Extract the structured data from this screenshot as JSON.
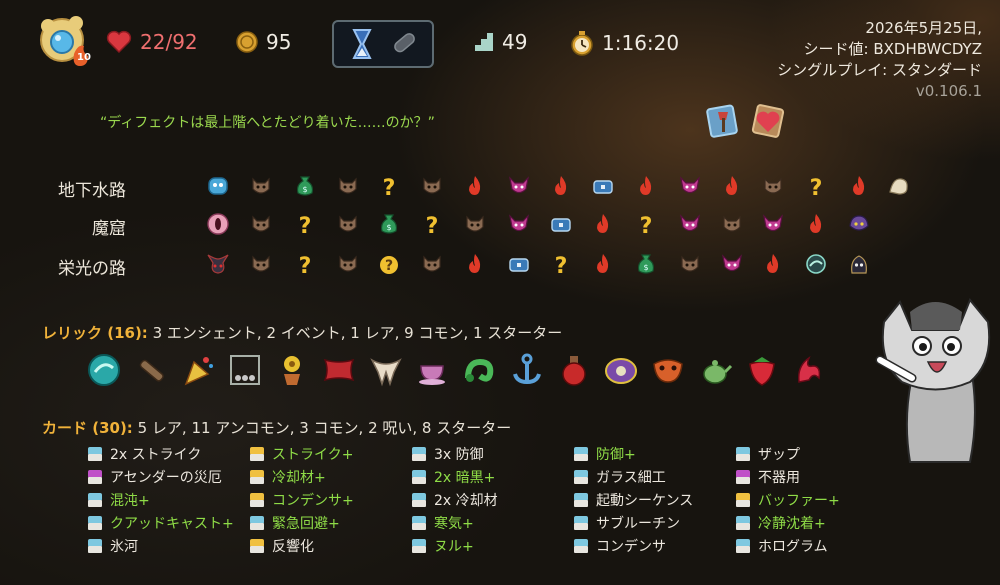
{
  "top_bar": {
    "ascension": "10",
    "hp": "22/92",
    "gold": "95",
    "floor": "49",
    "time": "1:16:20"
  },
  "run_info": {
    "date": "2026年5月25日,",
    "seed": "シード値: BXDHBWCDYZ",
    "mode": "シングルプレイ: スタンダード",
    "version": "v0.106.1"
  },
  "quote": "“ディフェクトは最上階へとたどり着いた……のか？”",
  "colors": {
    "accent_gold": "#f0b23a",
    "upgraded_green": "#8fdc47",
    "hp_red": "#ef6f6f"
  },
  "map": {
    "acts": [
      {
        "name": "地下水路",
        "boss_icon": "blue-slime-boss-icon",
        "nodes": [
          "monster",
          "treasure",
          "monster",
          "unknown",
          "monster",
          "elite",
          "elite",
          "elite",
          "chest",
          "elite",
          "elite",
          "elite",
          "monster",
          "unknown",
          "elite",
          "boss-scroll"
        ]
      },
      {
        "name": "魔窟",
        "boss_icon": "eye-boss-icon",
        "nodes": [
          "monster",
          "unknown",
          "monster",
          "treasure",
          "unknown",
          "monster",
          "elite",
          "chest",
          "elite",
          "unknown",
          "elite",
          "monster",
          "elite",
          "elite",
          "boss-shadow"
        ]
      },
      {
        "name": "栄光の路",
        "boss_icon": "horned-boss-icon",
        "nodes": [
          "monster",
          "unknown",
          "monster",
          "unknown-event",
          "monster",
          "elite",
          "chest",
          "unknown",
          "elite",
          "treasure",
          "monster",
          "elite",
          "elite",
          "teal-orb",
          "boss-dark"
        ]
      }
    ]
  },
  "relics": {
    "label": "レリック (16):",
    "summary": "3 エンシェント, 2 イベント, 1 レア, 9 コモン, 1 スターター",
    "items": [
      "teal-orb-icon",
      "bone-club-icon",
      "party-popper-icon",
      "newton-cradle-icon",
      "flower-pot-icon",
      "red-pillow-icon",
      "tooth-necklace-icon",
      "teacup-icon",
      "green-serpent-icon",
      "anchor-icon",
      "potion-flask-icon",
      "purple-egg-icon",
      "orange-mask-icon",
      "green-teapot-icon",
      "strawberry-icon",
      "red-plume-icon"
    ]
  },
  "cards": {
    "label": "カード (30):",
    "summary": "5 レア, 11 アンコモン, 3 コモン, 2 呪い, 8 スターター",
    "items": [
      {
        "name": "2x ストライク",
        "upgraded": false
      },
      {
        "name": "ストライク+",
        "upgraded": true
      },
      {
        "name": "3x 防御",
        "upgraded": false
      },
      {
        "name": "防御+",
        "upgraded": true
      },
      {
        "name": "ザップ",
        "upgraded": false
      },
      {
        "name": "アセンダーの災厄",
        "upgraded": false
      },
      {
        "name": "冷却材+",
        "upgraded": true
      },
      {
        "name": "2x 暗黒+",
        "upgraded": true
      },
      {
        "name": "ガラス細工",
        "upgraded": false
      },
      {
        "name": "不器用",
        "upgraded": false
      },
      {
        "name": "混沌+",
        "upgraded": true
      },
      {
        "name": "コンデンサ+",
        "upgraded": true
      },
      {
        "name": "2x 冷却材",
        "upgraded": false
      },
      {
        "name": "起動シーケンス",
        "upgraded": false
      },
      {
        "name": "バッファー+",
        "upgraded": true
      },
      {
        "name": "クアッドキャスト+",
        "upgraded": true
      },
      {
        "name": "緊急回避+",
        "upgraded": true
      },
      {
        "name": "寒気+",
        "upgraded": true
      },
      {
        "name": "サブルーチン",
        "upgraded": false
      },
      {
        "name": "冷静沈着+",
        "upgraded": true
      },
      {
        "name": "氷河",
        "upgraded": false
      },
      {
        "name": "反響化",
        "upgraded": false
      },
      {
        "name": "ヌル+",
        "upgraded": true
      },
      {
        "name": "コンデンサ",
        "upgraded": false
      },
      {
        "name": "ホログラム",
        "upgraded": false
      }
    ]
  }
}
